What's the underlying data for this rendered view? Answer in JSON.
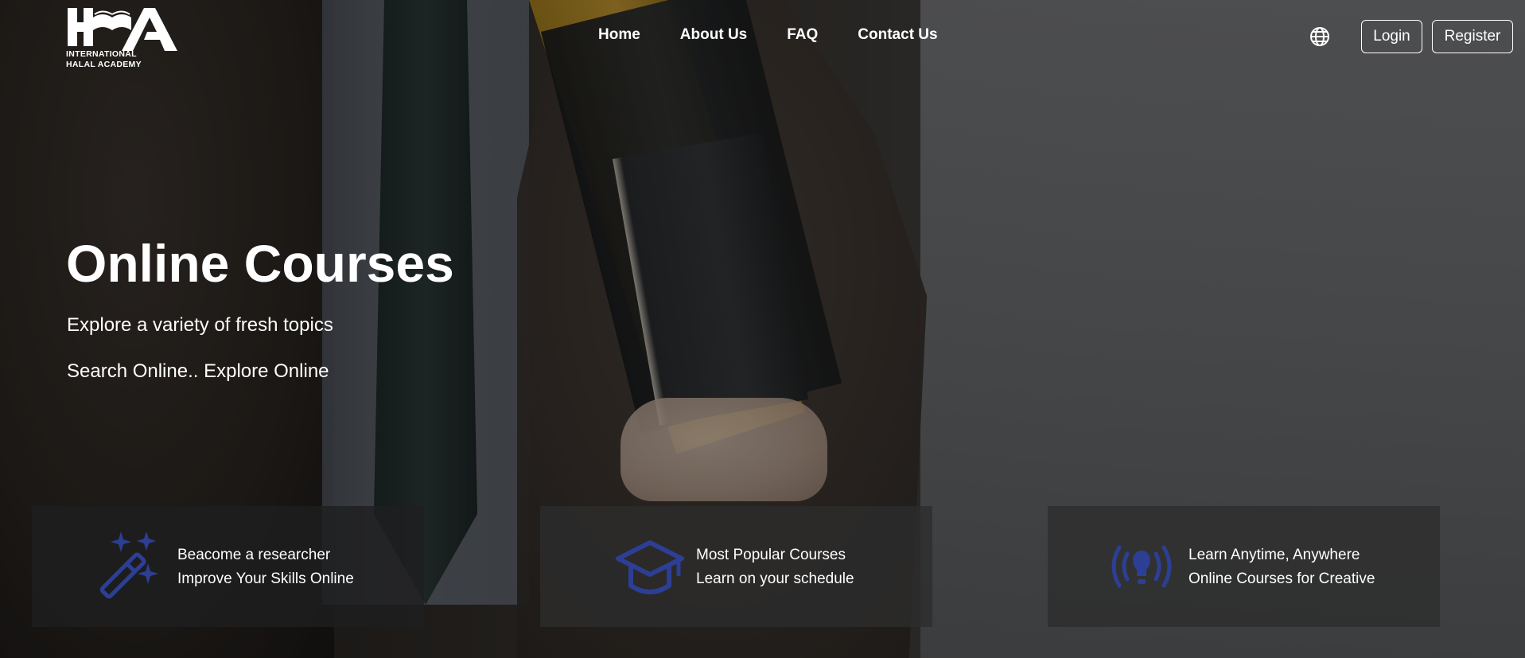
{
  "brand": {
    "line1": "INTERNATIONAL",
    "line2": "HALAL ACADEMY",
    "logo_icon": "ha-book-logo",
    "logo_color": "#ffffff"
  },
  "nav": {
    "items": [
      "Home",
      "About Us",
      "FAQ",
      "Contact Us"
    ]
  },
  "header_actions": {
    "language_icon": "globe-icon",
    "login_label": "Login",
    "register_label": "Register"
  },
  "hero": {
    "title": "Online Courses",
    "subtitle_1": "Explore a variety of fresh topics",
    "subtitle_2": "Search Online.. Explore Online"
  },
  "features": [
    {
      "icon": "magic-wand-sparkles-icon",
      "line1": "Beacome a researcher",
      "line2": "Improve Your Skills Online"
    },
    {
      "icon": "graduation-cap-icon",
      "line1": "Most Popular Courses",
      "line2": "Learn on your schedule"
    },
    {
      "icon": "broadcast-lightbulb-icon",
      "line1": "Learn Anytime, Anywhere",
      "line2": "Online Courses for Creative"
    }
  ],
  "colors": {
    "accent_icon": "#2d3f94",
    "card_bg": "#2d2d2d",
    "text": "#ffffff"
  }
}
